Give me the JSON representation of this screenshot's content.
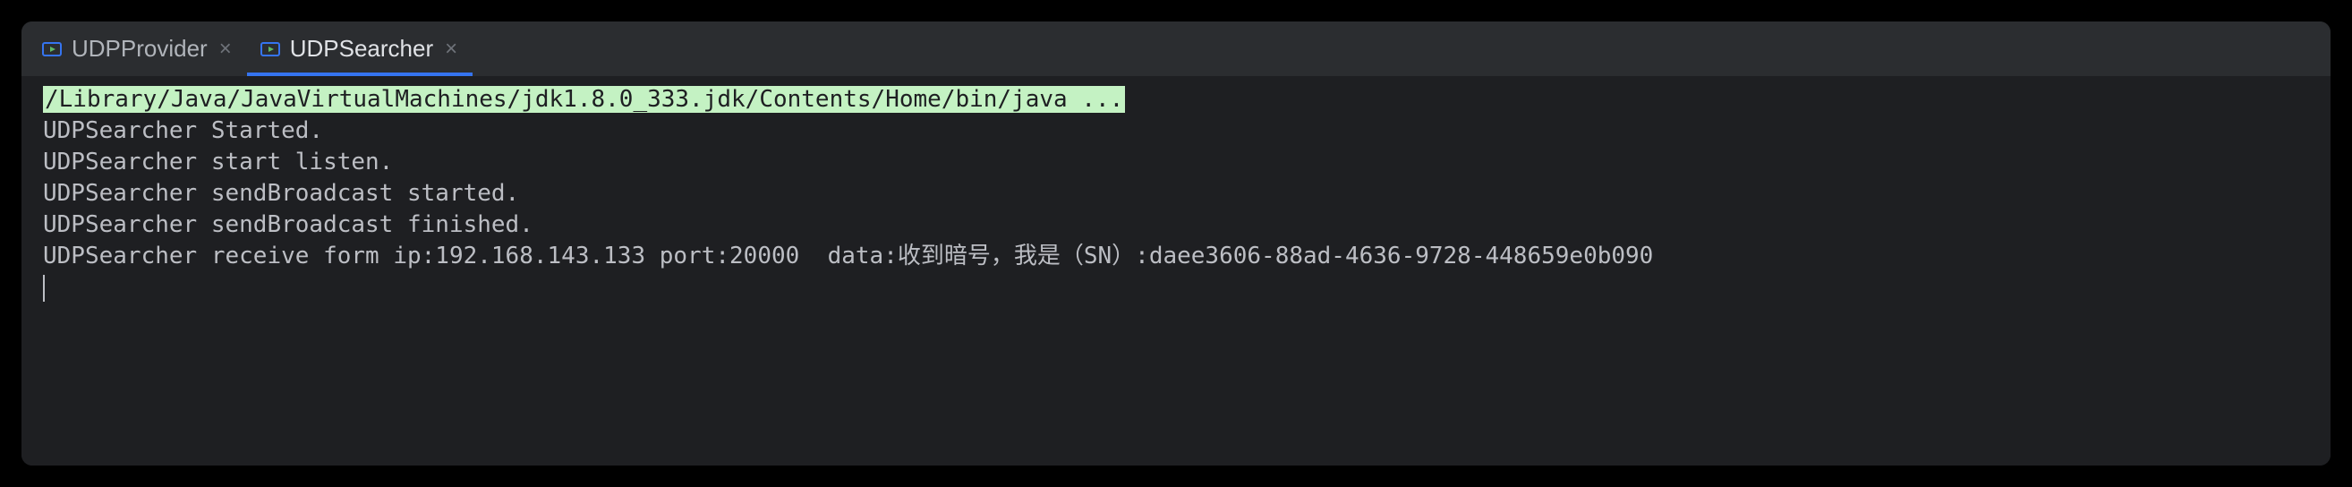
{
  "tabs": [
    {
      "label": "UDPProvider",
      "active": false
    },
    {
      "label": "UDPSearcher",
      "active": true
    }
  ],
  "console": {
    "command": "/Library/Java/JavaVirtualMachines/jdk1.8.0_333.jdk/Contents/Home/bin/java ...",
    "lines": [
      "UDPSearcher Started.",
      "UDPSearcher start listen.",
      "UDPSearcher sendBroadcast started.",
      "UDPSearcher sendBroadcast finished.",
      "UDPSearcher receive form ip:192.168.143.133 port:20000  data:收到暗号，我是（SN）:daee3606-88ad-4636-9728-448659e0b090"
    ]
  }
}
